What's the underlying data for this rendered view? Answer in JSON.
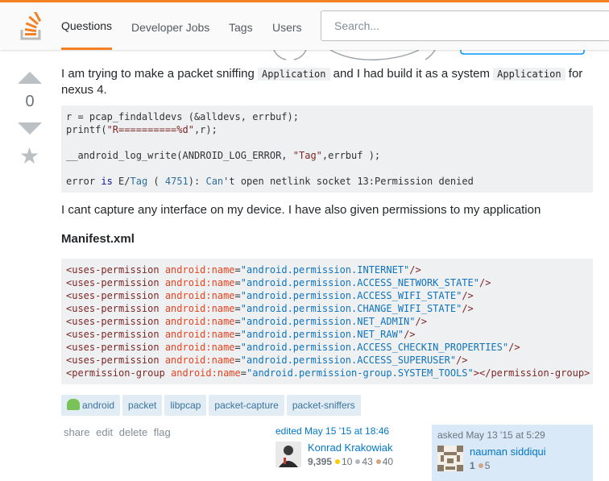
{
  "header": {
    "nav": [
      "Questions",
      "Developer Jobs",
      "Tags",
      "Users"
    ],
    "search_placeholder": "Search..."
  },
  "vote": {
    "count": "0"
  },
  "post": {
    "p1_before": "I am trying to make a packet sniffing ",
    "p1_code1": "Application",
    "p1_middle": " and I had build it as a system ",
    "p1_code2": "Application",
    "p1_after": " for nexus 4.",
    "code_block_1": [
      "r = pcap_findalldevs (&alldevs, errbuf);",
      "printf(\"R==========%d\",r);",
      "",
      "__android_log_write(ANDROID_LOG_ERROR, \"Tag\",errbuf );",
      "",
      "error is E/Tag ( 4751): Can't open netlink socket 13:Permission denied"
    ],
    "p2": "I cant capture any interface on my device. I have also given permissions to my application",
    "manifest_heading": "Manifest.xml",
    "manifest_lines": [
      "<uses-permission android:name=\"android.permission.INTERNET\"/>",
      "<uses-permission android:name=\"android.permission.ACCESS_NETWORK_STATE\"/>",
      "<uses-permission android:name=\"android.permission.ACCESS_WIFI_STATE\"/>",
      "<uses-permission android:name=\"android.permission.CHANGE_WIFI_STATE\"/>",
      "<uses-permission android:name=\"android.permission.NET_ADMIN\"/>",
      "<uses-permission android:name=\"android.permission.NET_RAW\"/>",
      "<uses-permission android:name=\"android.permission.ACCESS_CHECKIN_PROPERTIES\"/>",
      "<uses-permission android:name=\"android.permission.ACCESS_SUPERUSER\"/>",
      "<permission-group android:name=\"android.permission-group.SYSTEM_TOOLS\"></permission-group>"
    ]
  },
  "tags": [
    "android",
    "packet",
    "libpcap",
    "packet-capture",
    "packet-sniffers"
  ],
  "post_menu": [
    "share",
    "edit",
    "delete",
    "flag"
  ],
  "edited": {
    "when": "edited May 15 '15 at 18:46",
    "user": "Konrad Krakowiak",
    "rep": "9,395",
    "gold": "10",
    "silver": "43",
    "bronze": "40"
  },
  "asked": {
    "when": "asked May 13 '15 at 5:29",
    "user": "nauman siddiqui",
    "rep": "1",
    "bronze": "5"
  },
  "colors": {
    "accent": "#f48024",
    "link": "#0077cc",
    "tag_bg": "#e1ecf4",
    "tag_fg": "#39739d"
  }
}
